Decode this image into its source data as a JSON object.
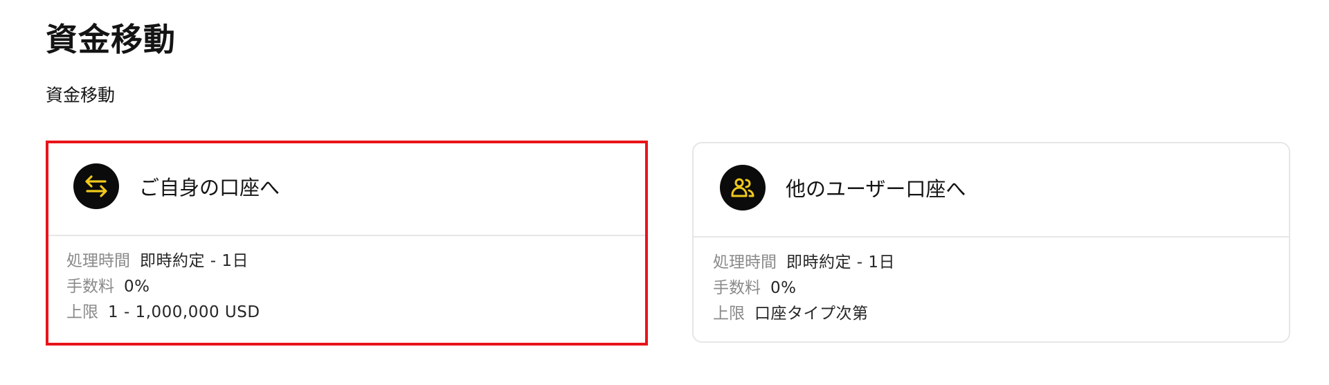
{
  "page": {
    "title": "資金移動",
    "section_title": "資金移動"
  },
  "cards": [
    {
      "icon": "transfer-arrows-icon",
      "title": "ご自身の口座へ",
      "rows": [
        {
          "label": "処理時間",
          "value": "即時約定 - 1日"
        },
        {
          "label": "手数料",
          "value": "0%"
        },
        {
          "label": "上限",
          "value": "1 - 1,000,000 USD"
        }
      ]
    },
    {
      "icon": "users-icon",
      "title": "他のユーザー口座へ",
      "rows": [
        {
          "label": "処理時間",
          "value": "即時約定 - 1日"
        },
        {
          "label": "手数料",
          "value": "0%"
        },
        {
          "label": "上限",
          "value": "口座タイプ次第"
        }
      ]
    }
  ],
  "colors": {
    "accent_icon": "#F0C91C",
    "highlight_border": "#E8141A",
    "icon_bg": "#0B0B0B",
    "divider": "#E6E6E6",
    "muted_label": "#8A8A8A",
    "text": "#141414"
  }
}
